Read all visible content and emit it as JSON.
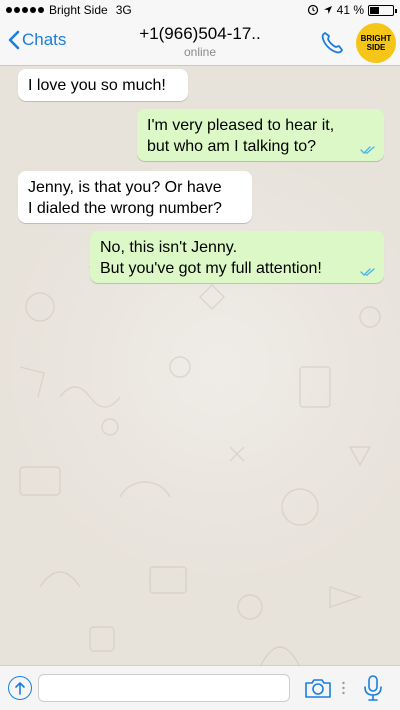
{
  "status_bar": {
    "carrier": "Bright Side",
    "network": "3G",
    "time": "",
    "battery_text": "41 %",
    "battery_level": 0.41
  },
  "nav": {
    "back_label": "Chats",
    "title": "+1(966)504-17..",
    "subtitle": "online",
    "logo_line1": "BRIGHT",
    "logo_line2": "SIDE"
  },
  "messages": [
    {
      "direction": "in",
      "lines": [
        "I love you so much!"
      ]
    },
    {
      "direction": "out",
      "lines": [
        "I'm very pleased to hear it,",
        "but who am I talking to?"
      ],
      "read": true
    },
    {
      "direction": "in",
      "lines": [
        "Jenny, is that you? Or have",
        "I dialed the wrong number?"
      ]
    },
    {
      "direction": "out",
      "lines": [
        "No, this isn't Jenny.",
        "But you've got my full attention!"
      ],
      "read": true
    }
  ],
  "input": {
    "placeholder": "",
    "value": ""
  },
  "colors": {
    "accent": "#1a7ee0",
    "outgoing_bubble": "#dcf8c6",
    "incoming_bubble": "#ffffff",
    "wallpaper": "#e7e2da",
    "logo_bg": "#f5c518"
  }
}
